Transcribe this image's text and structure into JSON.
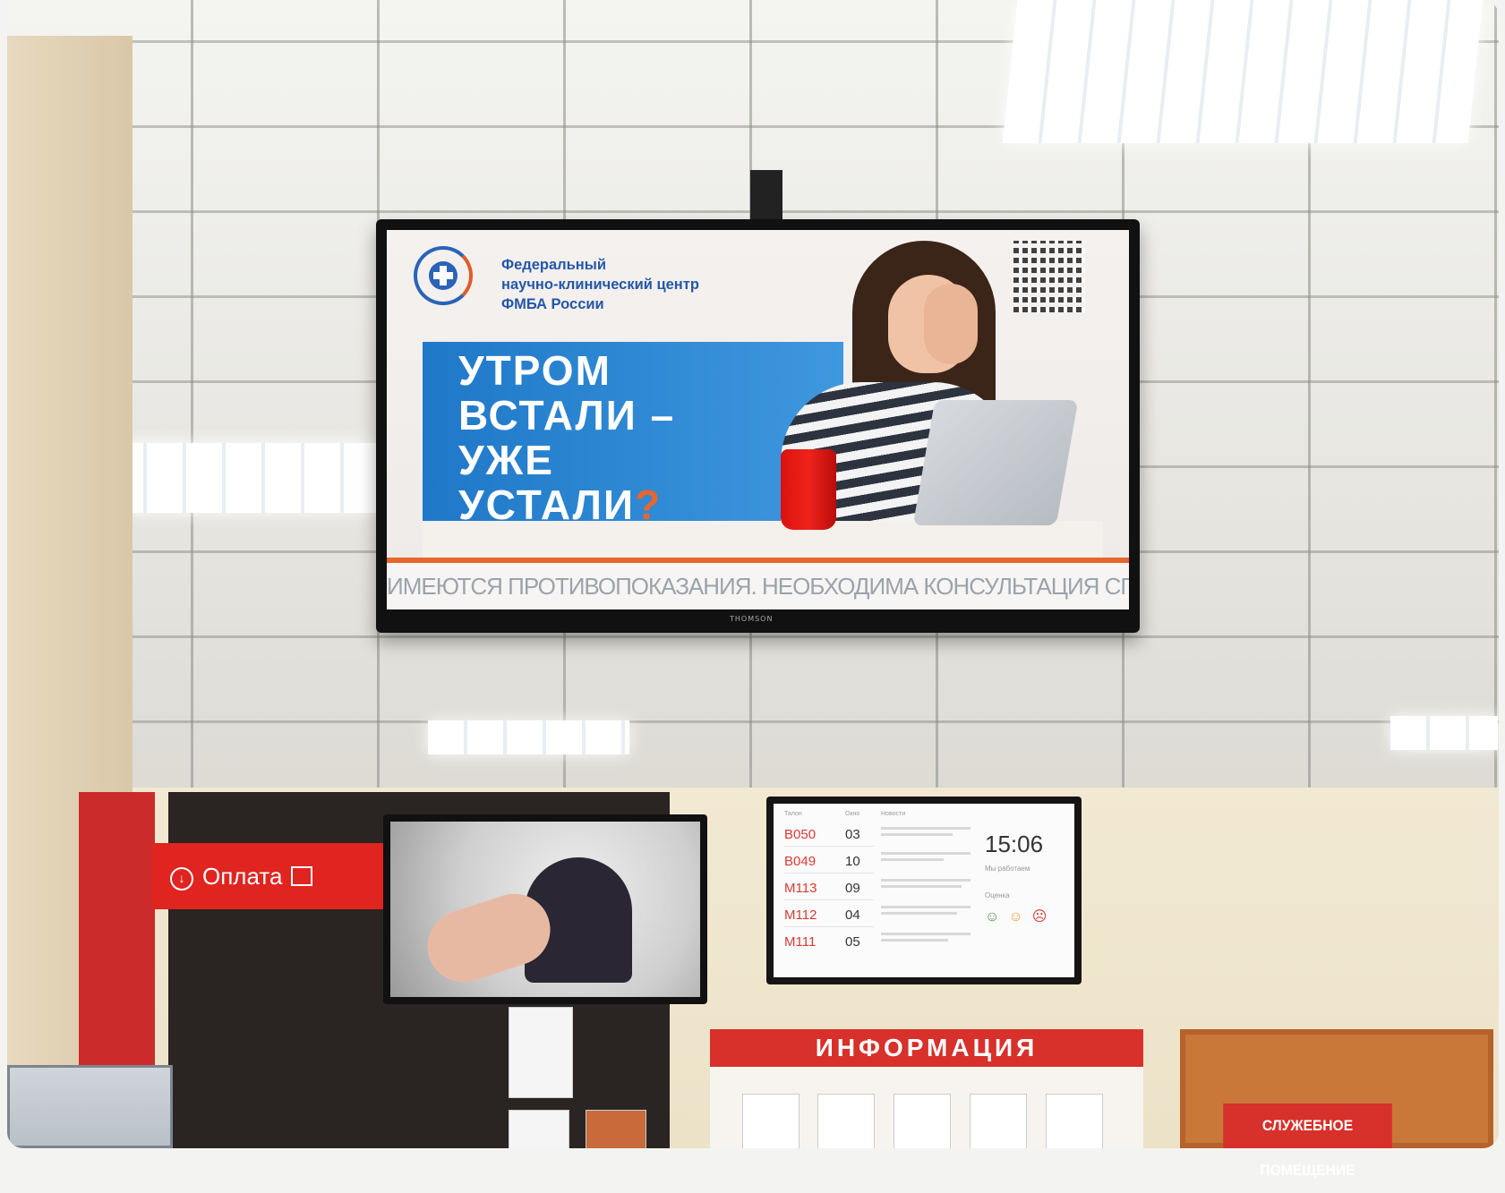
{
  "main_screen": {
    "org_line1": "Федеральный",
    "org_line2": "научно-клинический центр",
    "org_line3": "ФМБА России",
    "headline_line1": "УТРОМ",
    "headline_line2": "ВСТАЛИ –",
    "headline_line3": "УЖЕ",
    "headline_line4": "УСТАЛИ",
    "headline_mark": "?",
    "disclaimer": "ИМЕЮТСЯ ПРОТИВОПОКАЗАНИЯ. НЕОБХОДИМА КОНСУЛЬТАЦИЯ СПЕЦИАЛИСТА",
    "brand": "THOMSON"
  },
  "payment_sign": {
    "label": "Оплата",
    "icon": "arrow-down-circle-icon",
    "card_icon": "card-icon"
  },
  "queue_board": {
    "col_ticket": "Талон",
    "col_window": "Окно",
    "col_news": "Новости",
    "rows": [
      {
        "ticket": "B050",
        "window": "03"
      },
      {
        "ticket": "B049",
        "window": "10"
      },
      {
        "ticket": "M113",
        "window": "09"
      },
      {
        "ticket": "M112",
        "window": "04"
      },
      {
        "ticket": "M111",
        "window": "05"
      }
    ],
    "time": "15:06",
    "hours_label": "Мы работаем",
    "rating_label": "Оценка"
  },
  "info_board": {
    "title": "ИНФОРМАЦИЯ"
  },
  "service_sign": {
    "label": "СЛУЖЕБНОЕ ПОМЕЩЕНИЕ"
  },
  "colors": {
    "brand_red": "#d8302a",
    "brand_blue": "#2457a8",
    "accent_orange": "#e8652e"
  }
}
